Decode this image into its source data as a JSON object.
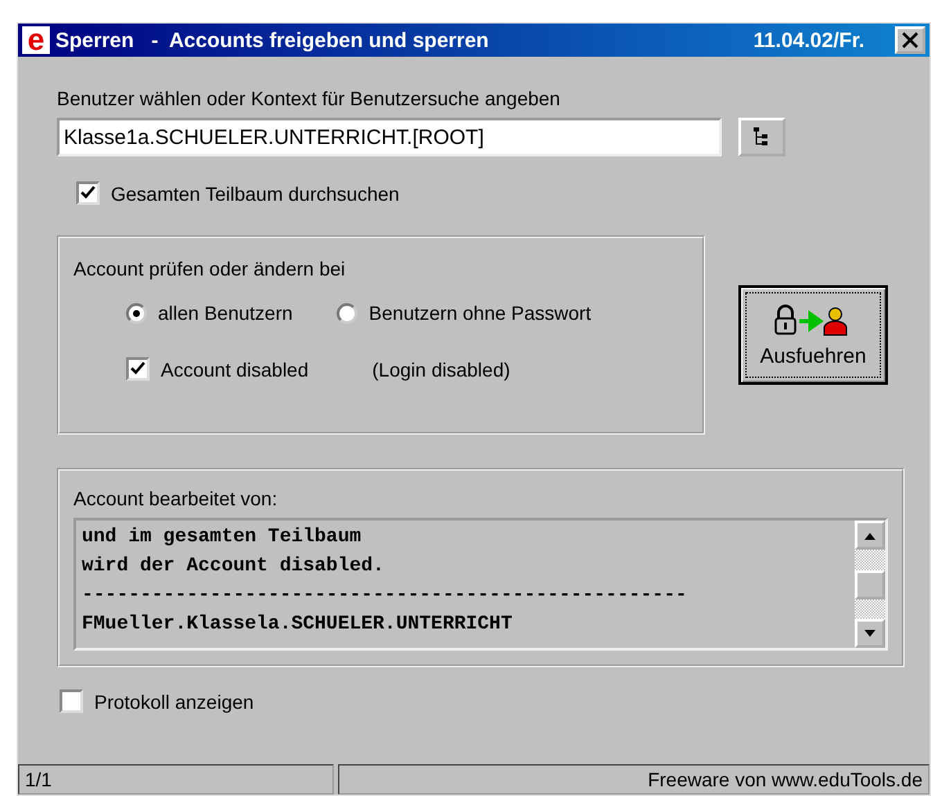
{
  "window": {
    "app_icon": "e",
    "title": "Sperren   -  Accounts freigeben und sperren",
    "date": "11.04.02/Fr."
  },
  "context": {
    "label": "Benutzer wählen oder Kontext für Benutzersuche angeben",
    "value": "Klasse1a.SCHUELER.UNTERRICHT.[ROOT]"
  },
  "search_subtree": {
    "label": "Gesamten Teilbaum durchsuchen",
    "checked": true
  },
  "check_group": {
    "title": "Account prüfen oder ändern bei",
    "options": [
      {
        "label": "allen Benutzern",
        "selected": true
      },
      {
        "label": "Benutzern ohne Passwort",
        "selected": false
      }
    ],
    "account_disabled": {
      "label": "Account disabled",
      "checked": true
    },
    "note": "(Login disabled)"
  },
  "execute_button": {
    "label": "Ausfuehren"
  },
  "log_group": {
    "title": "Account bearbeitet von:",
    "lines": [
      "und im gesamten Teilbaum",
      "wird der Account disabled.",
      "----------------------------------------------------",
      "FMueller.Klassela.SCHUELER.UNTERRICHT"
    ]
  },
  "show_log": {
    "label": "Protokoll anzeigen",
    "checked": false
  },
  "status_bar": {
    "page": "1/1",
    "credit": "Freeware von www.eduTools.de"
  }
}
